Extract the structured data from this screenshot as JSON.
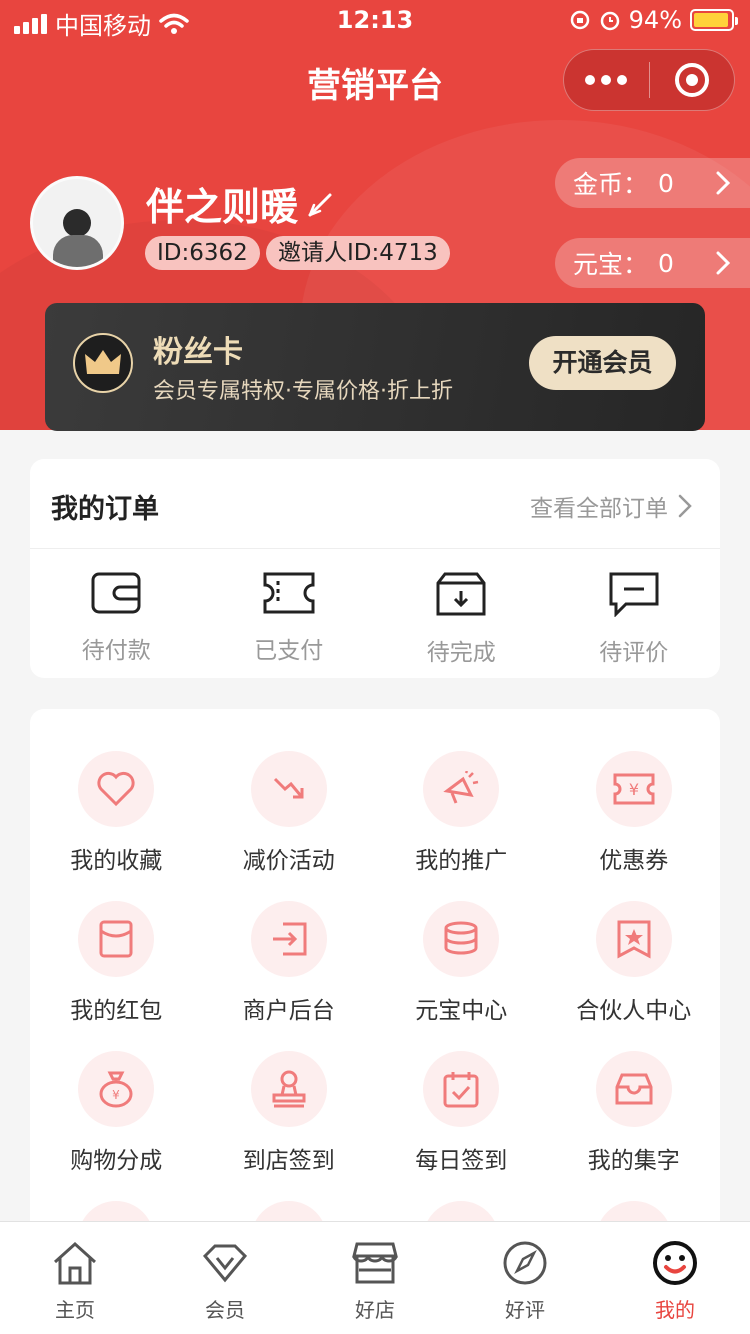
{
  "status_bar": {
    "carrier": "中国移动",
    "time": "12:13",
    "battery": "94%"
  },
  "nav": {
    "title": "营销平台"
  },
  "profile": {
    "name": "伴之则暖",
    "id_tag": "ID:6362",
    "inviter_tag": "邀请人ID:4713",
    "coins_label": "金币：",
    "coins_value": "0",
    "yuanbao_label": "元宝：",
    "yuanbao_value": "0"
  },
  "fans_card": {
    "title": "粉丝卡",
    "subtitle": "会员专属特权·专属价格·折上折",
    "button": "开通会员"
  },
  "orders": {
    "title": "我的订单",
    "view_all": "查看全部订单",
    "items": [
      {
        "label": "待付款",
        "icon": "wallet-icon"
      },
      {
        "label": "已支付",
        "icon": "ticket-icon"
      },
      {
        "label": "待完成",
        "icon": "box-download-icon"
      },
      {
        "label": "待评价",
        "icon": "chat-icon"
      }
    ]
  },
  "services": [
    {
      "label": "我的收藏",
      "icon": "heart-icon"
    },
    {
      "label": "减价活动",
      "icon": "trend-down-icon"
    },
    {
      "label": "我的推广",
      "icon": "megaphone-icon"
    },
    {
      "label": "优惠券",
      "icon": "yen-coupon-icon"
    },
    {
      "label": "我的红包",
      "icon": "red-envelope-icon"
    },
    {
      "label": "商户后台",
      "icon": "login-arrow-icon"
    },
    {
      "label": "元宝中心",
      "icon": "coin-stack-icon"
    },
    {
      "label": "合伙人中心",
      "icon": "star-bookmark-icon"
    },
    {
      "label": "购物分成",
      "icon": "money-bag-icon"
    },
    {
      "label": "到店签到",
      "icon": "stamp-icon"
    },
    {
      "label": "每日签到",
      "icon": "calendar-check-icon"
    },
    {
      "label": "我的集字",
      "icon": "tray-icon"
    }
  ],
  "tabbar": {
    "active": "我的",
    "items": [
      {
        "label": "主页",
        "icon": "home-icon"
      },
      {
        "label": "会员",
        "icon": "diamond-icon"
      },
      {
        "label": "好店",
        "icon": "store-icon"
      },
      {
        "label": "好评",
        "icon": "compass-icon"
      },
      {
        "label": "我的",
        "icon": "smile-face-icon"
      }
    ]
  },
  "colors": {
    "brand_red": "#e8453f",
    "gold": "#efe0c5",
    "icon_pink": "#f07b7b"
  }
}
